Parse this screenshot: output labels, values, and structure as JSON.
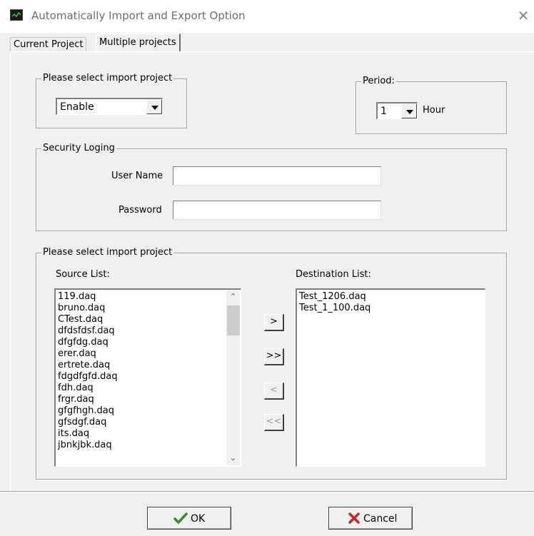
{
  "window": {
    "title": "Automatically Import and Export Option",
    "icon": "chart-monitor-icon",
    "close_glyph": "✕"
  },
  "tabs": [
    {
      "label": "Current Project",
      "active": false
    },
    {
      "label": "Multiple projects",
      "active": true
    }
  ],
  "import_group": {
    "legend": "Please select import project",
    "select_value": "Enable"
  },
  "period_group": {
    "legend": "Period:",
    "value": "1",
    "unit": "Hour"
  },
  "security_group": {
    "legend": "Security Loging",
    "username_label": "User Name",
    "username_value": "",
    "password_label": "Password",
    "password_value": ""
  },
  "project_group": {
    "legend": "Please select import project",
    "source_label": "Source List:",
    "destination_label": "Destination List:",
    "source_items": [
      "119.daq",
      "bruno.daq",
      "CTest.daq",
      "dfdsfdsf.daq",
      "dfgfdg.daq",
      "erer.daq",
      "ertrete.daq",
      "fdgdfgfd.daq",
      "fdh.daq",
      "frgr.daq",
      "gfgfhgh.daq",
      "gfsdgf.daq",
      "its.daq",
      "jbnkjbk.daq"
    ],
    "destination_items": [
      "Test_1206.daq",
      "Test_1_100.daq"
    ],
    "buttons": {
      "add": ">",
      "add_all": ">>",
      "remove": "<",
      "remove_all": "<<"
    }
  },
  "footer": {
    "ok_label": "OK",
    "cancel_label": "Cancel",
    "ok_icon": "checkmark-icon",
    "cancel_icon": "red-x-icon"
  },
  "colors": {
    "checkmark": "#2e8b2e",
    "cancel_x": "#c62828",
    "dialog_bg": "#f0f0f0"
  }
}
